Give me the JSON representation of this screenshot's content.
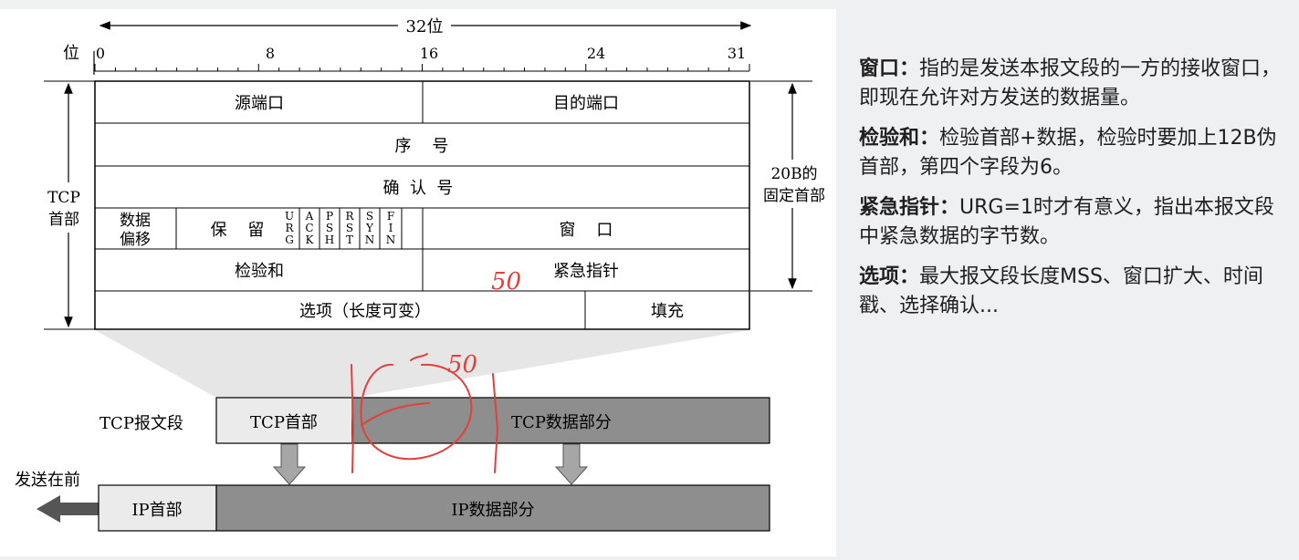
{
  "diagram": {
    "width_label": "32位",
    "bit_label": "位",
    "bit_ticks": [
      "0",
      "8",
      "16",
      "24",
      "31"
    ],
    "header_label_line1": "TCP",
    "header_label_line2": "首部",
    "fixed_label_line1": "20B的",
    "fixed_label_line2": "固定首部",
    "fields": {
      "src_port": "源端口",
      "dst_port": "目的端口",
      "seq": "序    号",
      "ack": "确  认  号",
      "offset_line1": "数据",
      "offset_line2": "偏移",
      "reserved": "保    留",
      "flags": [
        "URG",
        "ACK",
        "PSH",
        "RST",
        "SYN",
        "FIN"
      ],
      "window": "窗    口",
      "checksum": "检验和",
      "urgent": "紧急指针",
      "options": "选项（长度可变）",
      "padding": "填充"
    },
    "segment_label": "TCP报文段",
    "tcp_header": "TCP首部",
    "tcp_data": "TCP数据部分",
    "send_first": "发送在前",
    "ip_header": "IP首部",
    "ip_data": "IP数据部分",
    "annotations": [
      "50",
      "50"
    ]
  },
  "notes": [
    {
      "term": "窗口：",
      "text": "指的是发送本报文段的一方的接收窗口，即现在允许对方发送的数据量。"
    },
    {
      "term": "检验和：",
      "text": "检验首部+数据，检验时要加上12B伪首部，第四个字段为6。"
    },
    {
      "term": "紧急指针：",
      "text": "URG=1时才有意义，指出本报文段中紧急数据的字节数。"
    },
    {
      "term": "选项：",
      "text": "最大报文段长度MSS、窗口扩大、时间戳、选择确认..."
    }
  ],
  "colors": {
    "annotation": "#e0413a",
    "data_fill": "#8e8e8e",
    "header_fill": "#ebebeb",
    "arrow_fill": "#a6a6a6"
  }
}
